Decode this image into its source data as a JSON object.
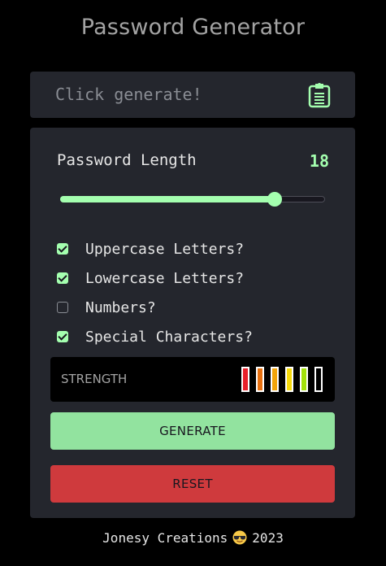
{
  "app": {
    "title": "Password Generator"
  },
  "output": {
    "placeholder_text": "Click generate!",
    "copy_icon": "clipboard-icon"
  },
  "length": {
    "label": "Password Length",
    "value": "18",
    "slider_fraction": 0.81
  },
  "options": [
    {
      "label": "Uppercase Letters?",
      "checked": true
    },
    {
      "label": "Lowercase Letters?",
      "checked": true
    },
    {
      "label": "Numbers?",
      "checked": false
    },
    {
      "label": "Special Characters?",
      "checked": true
    }
  ],
  "strength": {
    "label": "STRENGTH",
    "bars": [
      {
        "color": "#e8202a",
        "filled": false
      },
      {
        "color": "#e8700f",
        "filled": false
      },
      {
        "color": "#f2a40a",
        "filled": false
      },
      {
        "color": "#f5d90a",
        "filled": false
      },
      {
        "color": "#a3e10b",
        "filled": false
      },
      {
        "color": "#ffffff",
        "filled": false
      }
    ]
  },
  "buttons": {
    "generate_label": "GENERATE",
    "reset_label": "RESET"
  },
  "footer": {
    "text_before": "Jonesy Creations",
    "emoji_icon": "sunglasses-emoji-icon",
    "year": "2023"
  },
  "colors": {
    "accent": "#a4ffaf",
    "background": "#000000",
    "panel": "#24262d",
    "generate_button": "#92e39f",
    "reset_button": "#cf3a3d"
  }
}
